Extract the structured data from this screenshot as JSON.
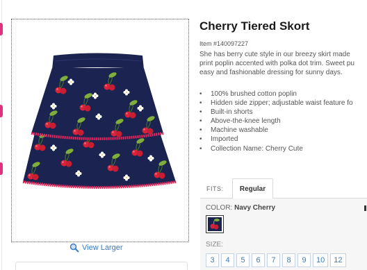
{
  "product": {
    "title": "Cherry Tiered Skort",
    "item_number": "Item #140097227",
    "description_lines": [
      "She has berry cute style in our breezy skirt made",
      "print poplin accented with polka dot trim. Sweet pu",
      "easy and fashionable dressing for sunny days."
    ],
    "features": [
      "100% brushed cotton poplin",
      "Hidden side zipper; adjustable waist feature fo",
      "Built-in shorts",
      "Above-the-knee length",
      "Machine washable",
      "Imported",
      "Collection Name: Cherry Cute"
    ]
  },
  "image": {
    "view_larger_label": "View Larger",
    "colors": {
      "fabric": "#1b2350",
      "trim": "#e8245a",
      "cherry": "#d8243a",
      "leaf": "#7fae3a"
    }
  },
  "fits": {
    "label": "FITS:",
    "tabs": [
      "Regular"
    ]
  },
  "options": {
    "color_label": "COLOR:",
    "color_value": "Navy Cherry",
    "size_label": "SIZE:",
    "sizes": [
      "3",
      "4",
      "5",
      "6",
      "7",
      "8",
      "9",
      "10",
      "12"
    ]
  },
  "theme": {
    "accent_link": "#3b7bbf",
    "edge_tab": "#e0317e"
  }
}
